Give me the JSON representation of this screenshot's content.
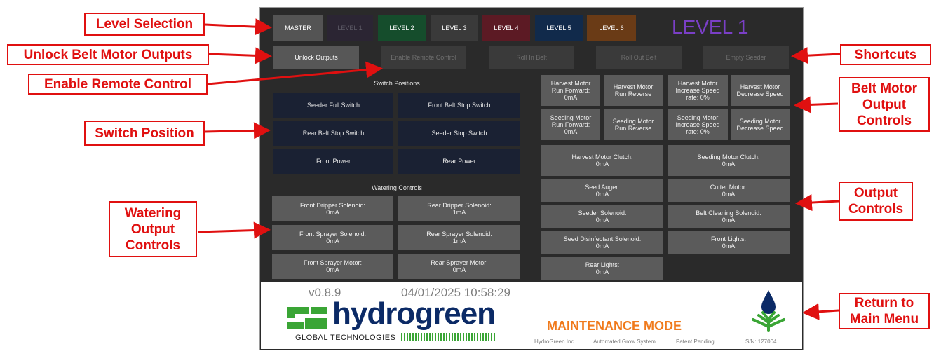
{
  "levels": {
    "buttons": [
      {
        "label": "MASTER",
        "bg": "#545454",
        "fg": "#ffffff"
      },
      {
        "label": "LEVEL 1",
        "bg": "#2b2533",
        "fg": "#5d5a66"
      },
      {
        "label": "LEVEL 2",
        "bg": "#154d2c",
        "fg": "#ffffff"
      },
      {
        "label": "LEVEL 3",
        "bg": "#3a3a3a",
        "fg": "#ffffff"
      },
      {
        "label": "LEVEL 4",
        "bg": "#5c1a24",
        "fg": "#ffffff"
      },
      {
        "label": "LEVEL 5",
        "bg": "#112a4b",
        "fg": "#ffffff"
      },
      {
        "label": "LEVEL 6",
        "bg": "#6a3b16",
        "fg": "#ffffff"
      }
    ],
    "current": "LEVEL 1",
    "current_color": "#7a3fc6"
  },
  "shortcuts": {
    "unlock": "Unlock Outputs",
    "remote": "Enable Remote Control",
    "roll_in": "Roll In Belt",
    "roll_out": "Roll Out Belt",
    "empty": "Empty Seeder"
  },
  "switch_positions": {
    "title": "Switch Positions",
    "items": [
      "Seeder Full Switch",
      "Front Belt Stop Switch",
      "Rear Belt Stop Switch",
      "Seeder Stop Switch",
      "Front Power",
      "Rear Power"
    ]
  },
  "watering": {
    "title": "Watering Controls",
    "items": [
      "Front Dripper Solenoid:\n0mA",
      "Rear Dripper Solenoid:\n1mA",
      "Front Sprayer Solenoid:\n0mA",
      "Rear Sprayer Solenoid:\n1mA",
      "Front Sprayer Motor:\n0mA",
      "Rear Sprayer Motor:\n0mA"
    ]
  },
  "belt_motor": {
    "items": [
      "Harvest Motor\nRun Forward:\n0mA",
      "Harvest Motor\nRun Reverse",
      "Harvest Motor\nIncrease Speed\nrate: 0%",
      "Harvest Motor\nDecrease Speed",
      "Seeding Motor\nRun Forward:\n0mA",
      "Seeding Motor\nRun Reverse",
      "Seeding Motor\nIncrease Speed\nrate: 0%",
      "Seeding Motor\nDecrease Speed"
    ]
  },
  "outputs": {
    "items": [
      "Harvest Motor Clutch:\n0mA",
      "Seeding Motor Clutch:\n0mA",
      "Seed Auger:\n0mA",
      "Cutter Motor:\n0mA",
      "Seeder Solenoid:\n0mA",
      "Belt Cleaning Solenoid:\n0mA",
      "Seed Disinfectant Solenoid:\n0mA",
      "Front Lights:\n0mA",
      "Rear Lights:\n0mA"
    ]
  },
  "footer": {
    "version": "v0.8.9",
    "datetime": "04/01/2025 10:58:29",
    "brand": "hydrogreen",
    "brand_sub": "GLOBAL TECHNOLOGIES",
    "mode": "MAINTENANCE MODE",
    "company": "HydroGreen Inc.",
    "system": "Automated Grow System",
    "patent": "Patent Pending",
    "serial": "S/N: 127004",
    "brand_color": "#3aa535",
    "mode_color": "#f07a1c"
  },
  "annotations": {
    "level_selection": "Level Selection",
    "unlock_belt": "Unlock Belt Motor Outputs",
    "enable_remote": "Enable Remote Control",
    "switch_position": "Switch Position",
    "watering_output": "Watering\nOutput\nControls",
    "shortcuts": "Shortcuts",
    "belt_motor": "Belt Motor\nOutput\nControls",
    "output_controls": "Output\nControls",
    "return_menu": "Return to\nMain Menu"
  }
}
